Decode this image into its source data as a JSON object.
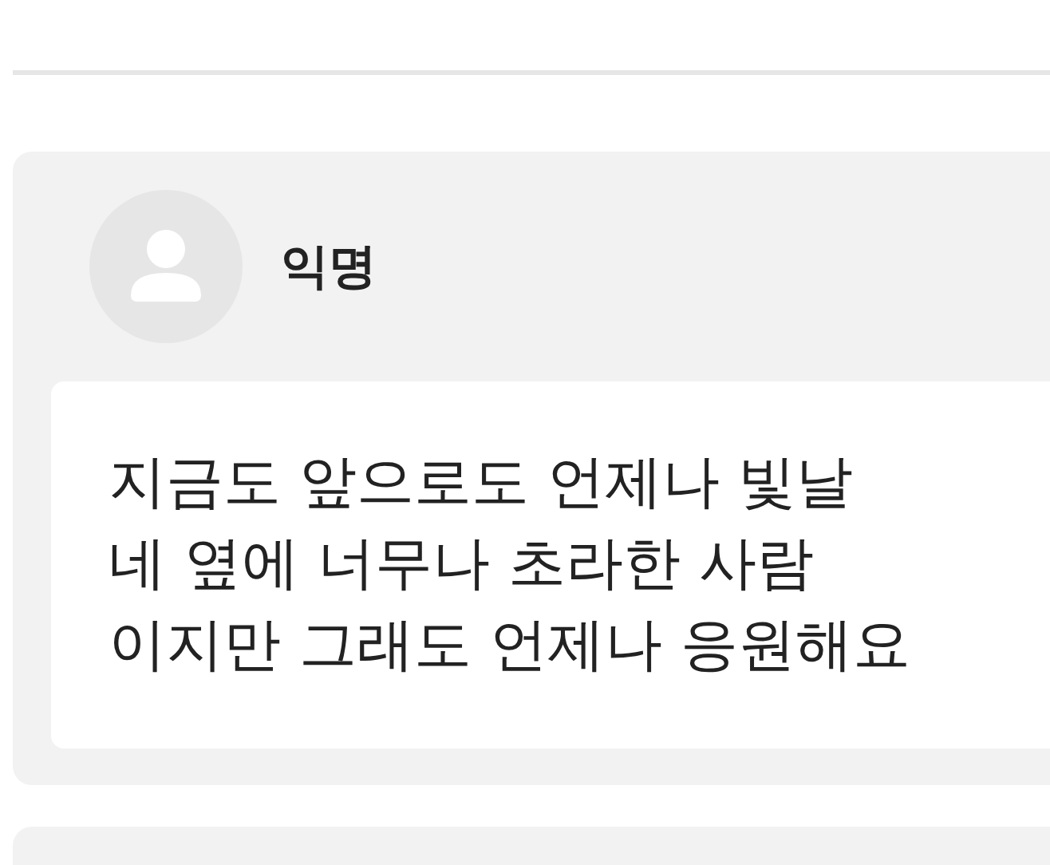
{
  "post": {
    "author": "익명",
    "body": "지금도 앞으로도 언제나 빛날\n네 옆에 너무나 초라한 사람\n이지만 그래도 언제나 응원해요"
  }
}
